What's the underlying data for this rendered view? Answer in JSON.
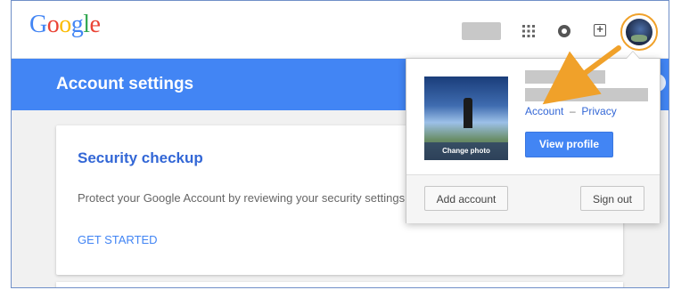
{
  "header": {
    "logo_letters": [
      {
        "char": "G",
        "color": "#4285f4"
      },
      {
        "char": "o",
        "color": "#ea4335"
      },
      {
        "char": "o",
        "color": "#fbbc05"
      },
      {
        "char": "g",
        "color": "#4285f4"
      },
      {
        "char": "l",
        "color": "#34a853"
      },
      {
        "char": "e",
        "color": "#ea4335"
      }
    ],
    "icons": [
      "apps-icon",
      "notifications-icon",
      "share-icon",
      "avatar"
    ]
  },
  "page": {
    "title": "Account settings",
    "help_icon": "?"
  },
  "card": {
    "title": "Security checkup",
    "body": "Protect your Google Account by reviewing your security settings",
    "link": "GET STARTED"
  },
  "dropdown": {
    "photo_caption": "Change photo",
    "account_link": "Account",
    "separator": "–",
    "privacy_link": "Privacy",
    "view_profile": "View profile",
    "add_account": "Add account",
    "sign_out": "Sign out"
  },
  "colors": {
    "brand_blue": "#4285f4",
    "annotation_orange": "#f0a12a"
  }
}
